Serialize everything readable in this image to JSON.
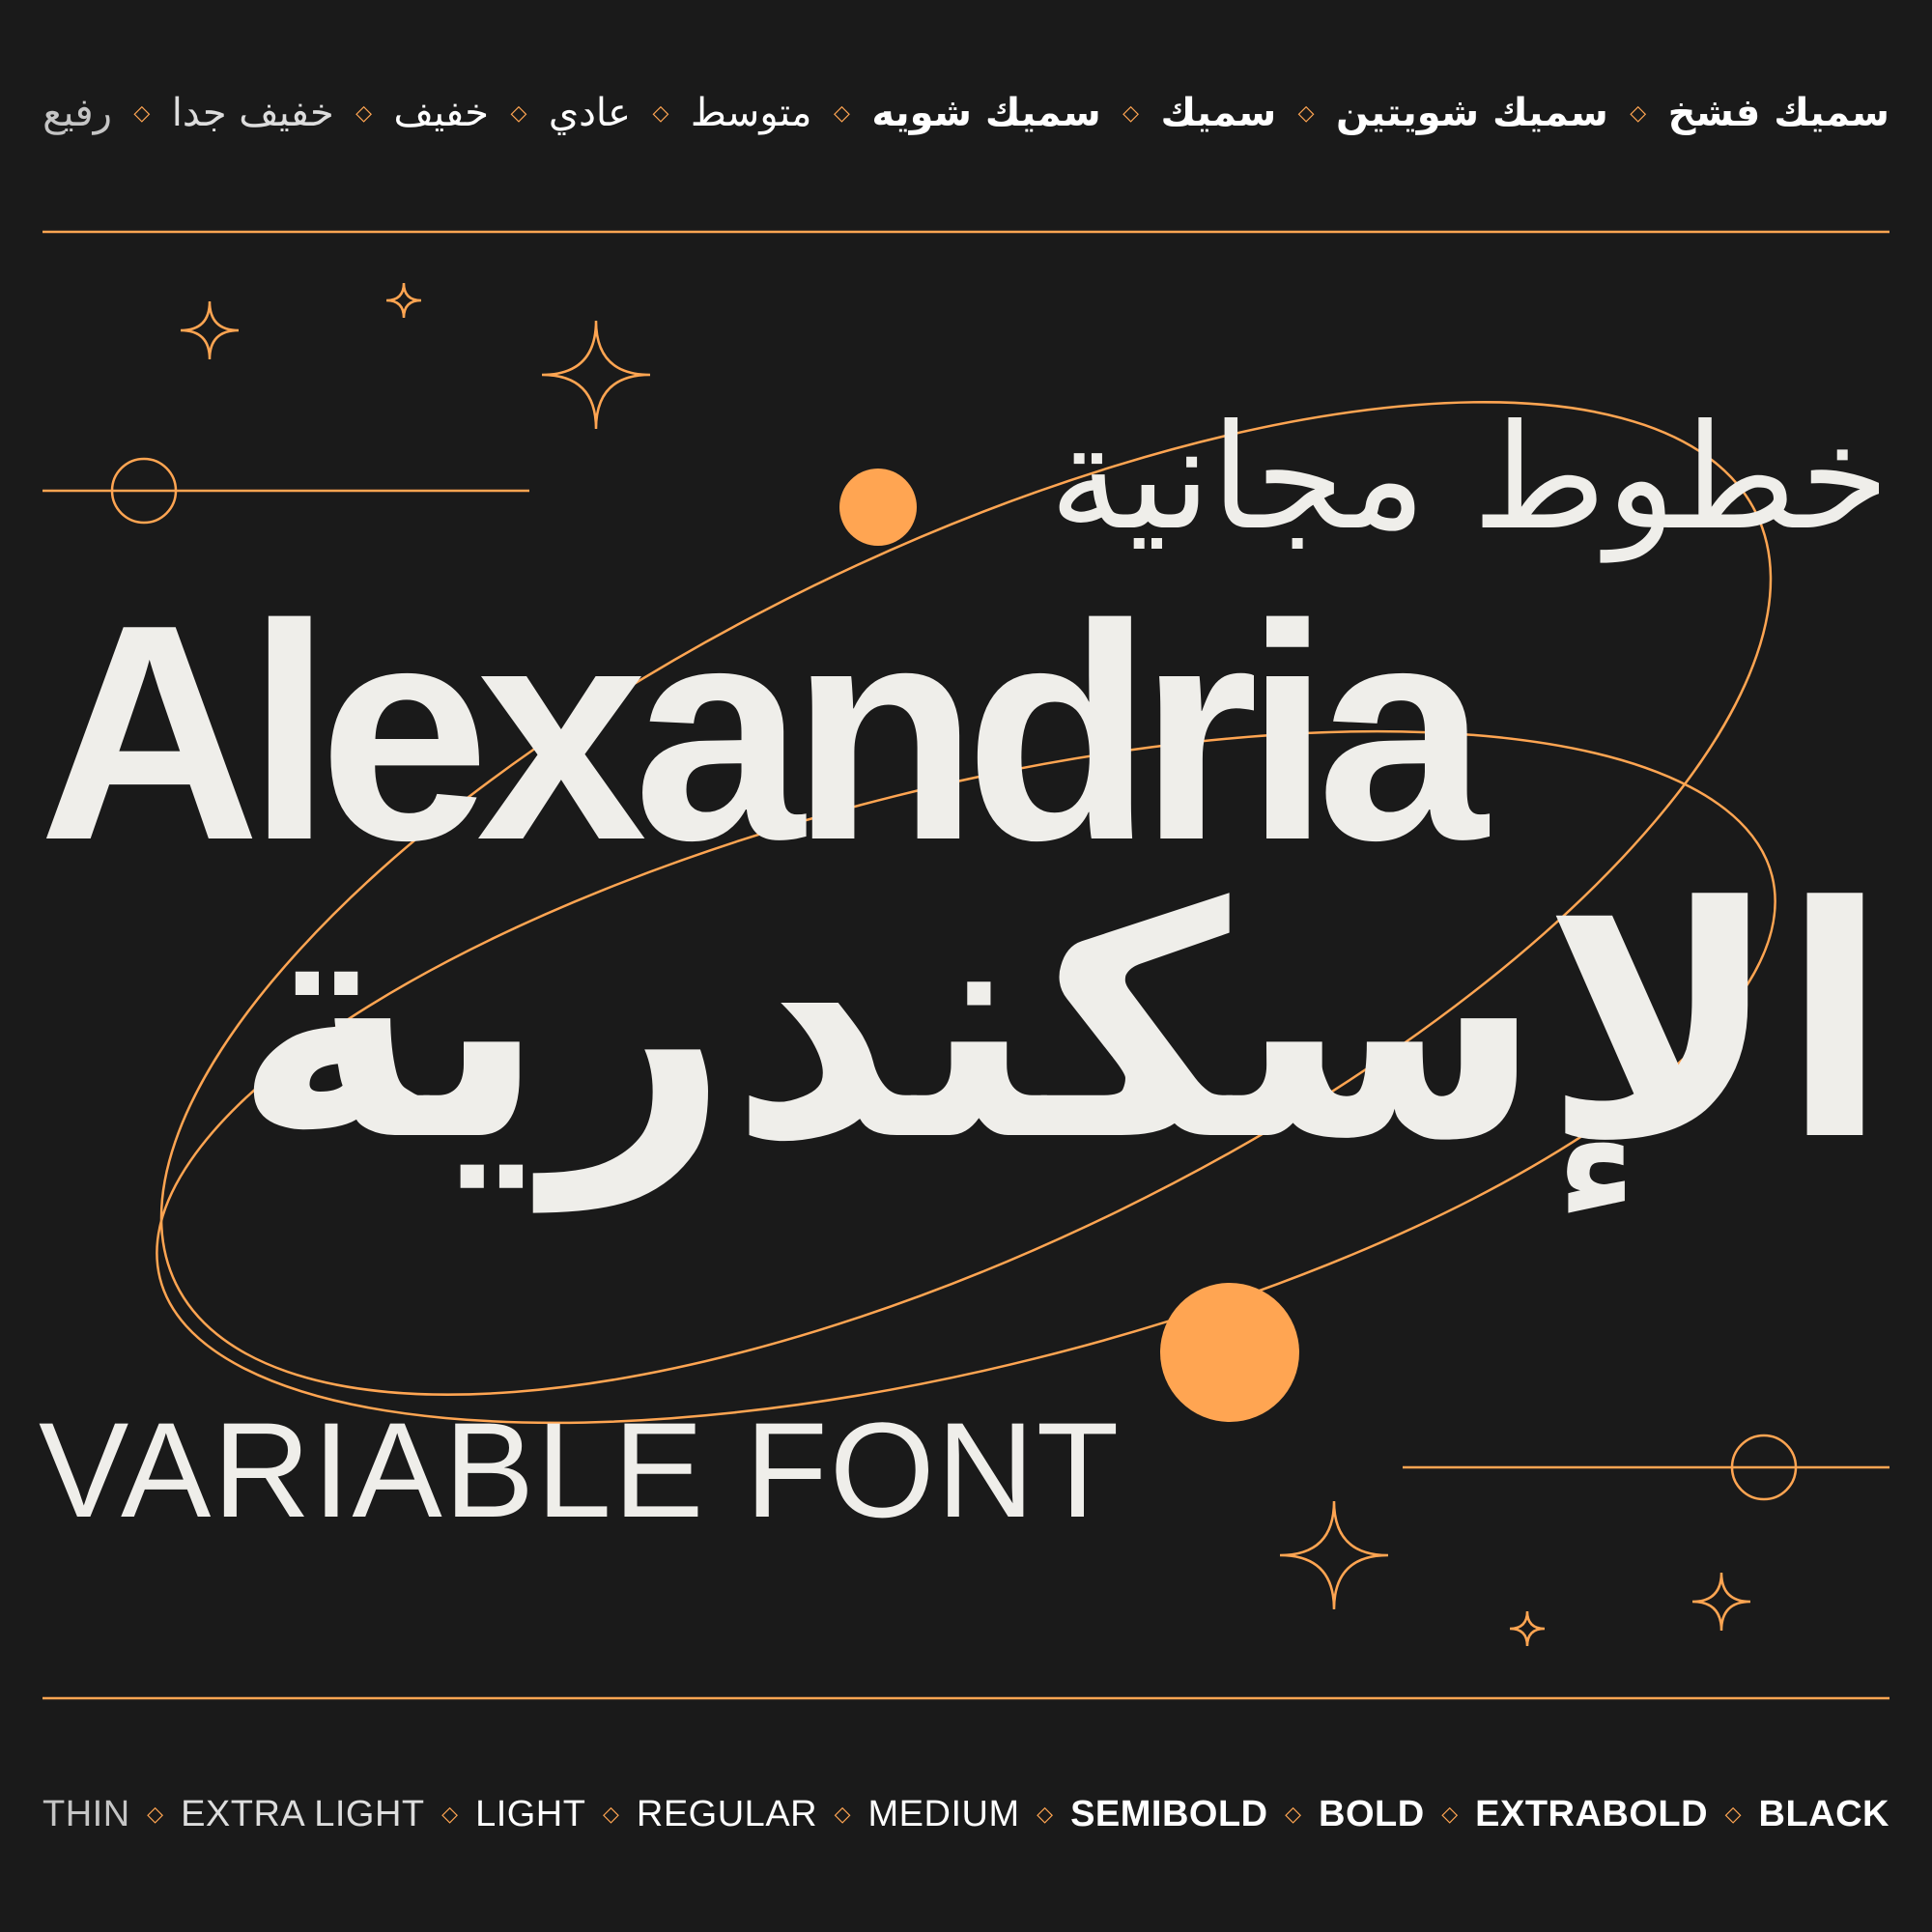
{
  "arabic_weights": [
    "رفيع",
    "خفيف جدا",
    "خفيف",
    "عادي",
    "متوسط",
    "سميك شويه",
    "سميك",
    "سميك شويتين",
    "سميك فشخ"
  ],
  "title_arabic_light": "خطوط مجانية",
  "title_english": "Alexandria",
  "title_arabic_bold": "الإسكندرية",
  "subtitle": "VARIABLE FONT",
  "english_weights": [
    "THIN",
    "EXTRA LIGHT",
    "LIGHT",
    "REGULAR",
    "MEDIUM",
    "SEMIBOLD",
    "BOLD",
    "EXTRABOLD",
    "BLACK"
  ],
  "separator_glyph": "◇",
  "colors": {
    "background": "#1a1a1a",
    "text": "#efeeea",
    "accent": "#ffa552"
  }
}
